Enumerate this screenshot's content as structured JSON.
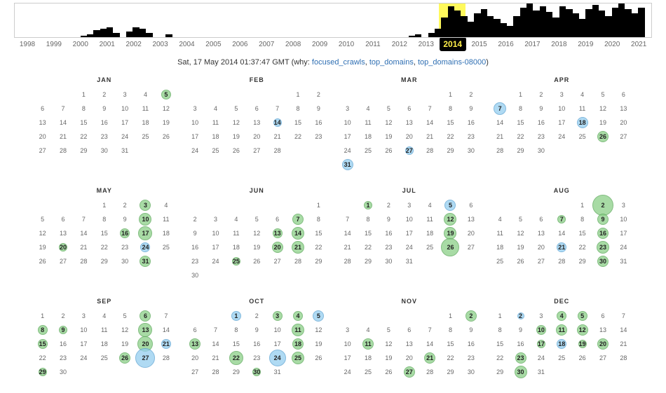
{
  "timeline": {
    "years": [
      "1998",
      "1999",
      "2000",
      "2001",
      "2002",
      "2003",
      "2004",
      "2005",
      "2006",
      "2007",
      "2008",
      "2009",
      "2010",
      "2011",
      "2012",
      "2013",
      "2014",
      "2015",
      "2016",
      "2017",
      "2018",
      "2019",
      "2020",
      "2021"
    ],
    "selected_year": "2014",
    "bars": [
      0,
      0,
      0,
      0,
      0,
      0,
      0,
      0,
      0,
      0,
      2,
      4,
      10,
      12,
      14,
      6,
      0,
      8,
      14,
      12,
      6,
      0,
      0,
      4,
      0,
      0,
      0,
      0,
      0,
      0,
      0,
      0,
      0,
      0,
      0,
      0,
      0,
      0,
      0,
      0,
      0,
      0,
      0,
      0,
      0,
      0,
      0,
      0,
      0,
      0,
      0,
      0,
      0,
      0,
      0,
      0,
      0,
      0,
      0,
      0,
      2,
      4,
      0,
      6,
      12,
      28,
      44,
      38,
      30,
      22,
      34,
      40,
      30,
      26,
      20,
      16,
      30,
      42,
      48,
      38,
      44,
      36,
      28,
      44,
      40,
      34,
      26,
      40,
      46,
      38,
      30,
      42,
      48,
      40,
      34,
      42,
      0
    ]
  },
  "headline": {
    "timestamp": "Sat, 17 May 2014 01:37:47 GMT",
    "why": "(why:",
    "links": [
      "focused_crawls",
      "top_domains",
      "top_domains-08000"
    ],
    "close": ")"
  },
  "months": [
    {
      "name": "JAN",
      "offset": 2,
      "days": 31,
      "captures": {
        "5": {
          "c": "green",
          "s": 14
        }
      }
    },
    {
      "name": "FEB",
      "offset": 5,
      "days": 28,
      "captures": {
        "14": {
          "c": "blue",
          "s": 12
        }
      }
    },
    {
      "name": "MAR",
      "offset": 5,
      "days": 31,
      "captures": {
        "27": {
          "c": "blue",
          "s": 12
        },
        "31": {
          "c": "blue",
          "s": 16
        }
      }
    },
    {
      "name": "APR",
      "offset": 1,
      "days": 30,
      "captures": {
        "7": {
          "c": "blue",
          "s": 18
        },
        "18": {
          "c": "blue",
          "s": 16
        },
        "26": {
          "c": "green",
          "s": 16
        }
      }
    },
    {
      "name": "MAY",
      "offset": 3,
      "days": 31,
      "captures": {
        "3": {
          "c": "green",
          "s": 16
        },
        "10": {
          "c": "green",
          "s": 18
        },
        "16": {
          "c": "green",
          "s": 14
        },
        "17": {
          "c": "green",
          "s": 20
        },
        "20": {
          "c": "green",
          "s": 12
        },
        "24": {
          "c": "blue",
          "s": 14
        },
        "31": {
          "c": "green",
          "s": 16
        }
      }
    },
    {
      "name": "JUN",
      "offset": 6,
      "days": 30,
      "captures": {
        "7": {
          "c": "green",
          "s": 16
        },
        "13": {
          "c": "green",
          "s": 14
        },
        "14": {
          "c": "green",
          "s": 18
        },
        "20": {
          "c": "green",
          "s": 16
        },
        "21": {
          "c": "green",
          "s": 18
        },
        "25": {
          "c": "green",
          "s": 12
        }
      }
    },
    {
      "name": "JUL",
      "offset": 1,
      "days": 31,
      "captures": {
        "1": {
          "c": "green",
          "s": 12
        },
        "5": {
          "c": "blue",
          "s": 16
        },
        "12": {
          "c": "green",
          "s": 18
        },
        "19": {
          "c": "green",
          "s": 18
        },
        "26": {
          "c": "green",
          "s": 26
        }
      }
    },
    {
      "name": "AUG",
      "offset": 4,
      "days": 31,
      "captures": {
        "2": {
          "c": "green",
          "s": 30
        },
        "7": {
          "c": "green",
          "s": 12
        },
        "9": {
          "c": "green",
          "s": 16
        },
        "16": {
          "c": "green",
          "s": 16
        },
        "21": {
          "c": "blue",
          "s": 14
        },
        "23": {
          "c": "green",
          "s": 18
        },
        "30": {
          "c": "green",
          "s": 16
        }
      }
    },
    {
      "name": "SEP",
      "offset": 0,
      "days": 30,
      "captures": {
        "6": {
          "c": "green",
          "s": 16
        },
        "8": {
          "c": "green",
          "s": 14
        },
        "9": {
          "c": "green",
          "s": 12
        },
        "13": {
          "c": "green",
          "s": 20
        },
        "15": {
          "c": "green",
          "s": 14
        },
        "20": {
          "c": "green",
          "s": 22
        },
        "21": {
          "c": "blue",
          "s": 14
        },
        "26": {
          "c": "green",
          "s": 16
        },
        "27": {
          "c": "blue",
          "s": 28
        },
        "29": {
          "c": "green",
          "s": 12
        }
      }
    },
    {
      "name": "OCT",
      "offset": 2,
      "days": 31,
      "captures": {
        "1": {
          "c": "blue",
          "s": 14
        },
        "3": {
          "c": "green",
          "s": 14
        },
        "4": {
          "c": "green",
          "s": 14
        },
        "5": {
          "c": "blue",
          "s": 16
        },
        "11": {
          "c": "green",
          "s": 18
        },
        "13": {
          "c": "green",
          "s": 16
        },
        "18": {
          "c": "green",
          "s": 16
        },
        "22": {
          "c": "green",
          "s": 20
        },
        "24": {
          "c": "blue",
          "s": 24
        },
        "25": {
          "c": "green",
          "s": 18
        },
        "30": {
          "c": "green",
          "s": 12
        }
      }
    },
    {
      "name": "NOV",
      "offset": 5,
      "days": 30,
      "captures": {
        "2": {
          "c": "green",
          "s": 16
        },
        "11": {
          "c": "green",
          "s": 16
        },
        "21": {
          "c": "green",
          "s": 16
        },
        "27": {
          "c": "green",
          "s": 16
        }
      }
    },
    {
      "name": "DEC",
      "offset": 0,
      "days": 31,
      "captures": {
        "2": {
          "c": "blue",
          "s": 10
        },
        "4": {
          "c": "green",
          "s": 14
        },
        "5": {
          "c": "green",
          "s": 14
        },
        "10": {
          "c": "green",
          "s": 14
        },
        "11": {
          "c": "green",
          "s": 16
        },
        "12": {
          "c": "green",
          "s": 16
        },
        "17": {
          "c": "green",
          "s": 12
        },
        "18": {
          "c": "blue",
          "s": 14
        },
        "19": {
          "c": "green",
          "s": 12
        },
        "20": {
          "c": "green",
          "s": 16
        },
        "23": {
          "c": "green",
          "s": 16
        },
        "30": {
          "c": "green",
          "s": 18
        }
      }
    }
  ]
}
